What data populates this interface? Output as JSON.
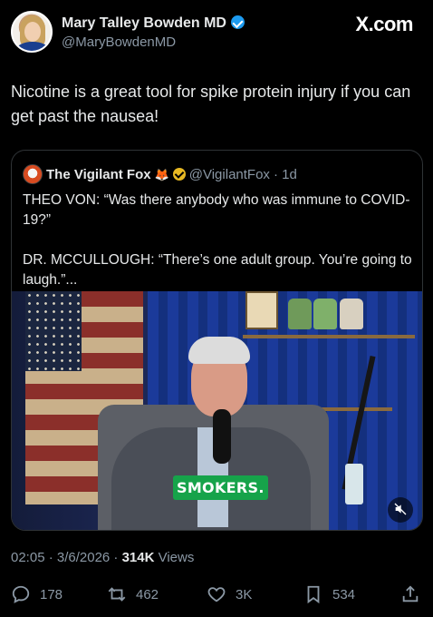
{
  "site_label": "X.com",
  "author": {
    "name": "Mary Talley Bowden MD",
    "handle": "@MaryBowdenMD"
  },
  "tweet": {
    "text": "Nicotine is a great tool for spike protein injury if you can get past the nausea!"
  },
  "quote": {
    "name": "The Vigilant Fox",
    "handle": "@VigilantFox",
    "time": "· 1d",
    "text": "THEO VON: “Was there anybody who was immune to COVID-19?”\n\nDR. MCCULLOUGH: “There’s one adult group. You’re going to laugh.”...",
    "video_caption": "SMOKERS."
  },
  "meta": {
    "timestamp": "02:05 · 3/6/2026 · ",
    "views_count": "314K",
    "views_label": " Views"
  },
  "actions": {
    "replies": "178",
    "reposts": "462",
    "likes": "3K",
    "bookmarks": "534"
  },
  "colors": {
    "background": "#000000",
    "text": "#e7e9ea",
    "muted": "#8b98a5",
    "verified": "#1d9bf0",
    "gold_badge": "#e8b923",
    "caption_bg": "#16a34a"
  },
  "icons": [
    "verified-badge-icon",
    "gold-verified-icon",
    "fox-emoji-icon",
    "mute-icon",
    "reply-icon",
    "repost-icon",
    "like-icon",
    "bookmark-icon",
    "share-icon"
  ]
}
